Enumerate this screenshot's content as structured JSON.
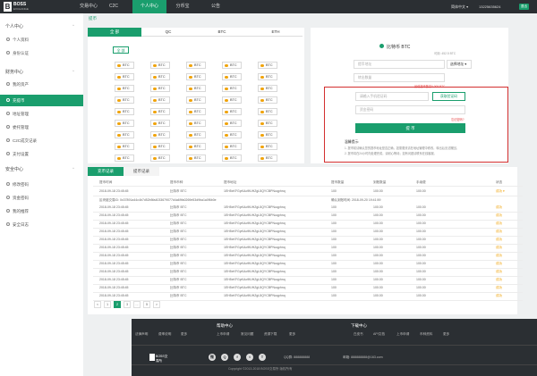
{
  "nav": {
    "logo_name": "BOSS",
    "logo_sub": "EXCHANGE",
    "items": [
      "交易中心",
      "C2C",
      "个人中心",
      "分币宝",
      "公告"
    ],
    "lang": "简体中文 ▾",
    "phone": "13225635624",
    "badge": "退出"
  },
  "sidebar": {
    "groups": [
      {
        "title": "个人中心",
        "items": [
          "个人资料",
          "身份认证"
        ]
      },
      {
        "title": "财务中心",
        "items": [
          "我的资产",
          "充提币",
          "地址管理",
          "委托管理",
          "C2C成交记录",
          "支付设置"
        ]
      },
      {
        "title": "安全中心",
        "items": [
          "修改密码",
          "资金密码",
          "我的推荐",
          "安全日志"
        ]
      }
    ],
    "active": "充提币"
  },
  "breadcrumb": "提币",
  "coins": {
    "tabs": [
      "全 部",
      "QC",
      "BTC",
      "ETH"
    ],
    "all_label": "全 部",
    "coin_label": "BTC"
  },
  "withdraw": {
    "title": "比特币 BTC",
    "subtitle": "可用: 452.5 BTC",
    "address_placeholder": "提币地址",
    "select_label": "选择地址 ▾",
    "amount_placeholder": "转出数量",
    "fee_note": "最低提币数量0.005 BTC",
    "code_placeholder": "请输入手机验证码",
    "code_button": "获取验证码",
    "fund_pw_placeholder": "资金密码",
    "forgot": "忘记密码?",
    "submit": "提 币",
    "tips_title": "温馨提示:",
    "tips": [
      "1. 提币前请确认您的提币地址是否正确，如需更改请在地址管理中修改，转出后无法撤回。",
      "2. 提币将在24小时内处理完成，请耐心等待；如有问题请联系在线客服。"
    ]
  },
  "records": {
    "tabs": [
      "充币记录",
      "提币记录"
    ],
    "headers": [
      "提币时间",
      "提币币种",
      "提币地址",
      "提币数量",
      "到账数量",
      "手续费",
      "状态"
    ],
    "rows": [
      {
        "time": "2018-09-18 23:45:45",
        "coin": "比特币 BTC",
        "addr": "1EH5xKFGpKAo9fUHZgL5QYCBPNuqphnq",
        "qty": "100",
        "net": "100.00",
        "fee": "100.00",
        "status": "成功 ▾"
      },
      {
        "time": "2018-09-18 23:45:45",
        "coin": "比特币 BTC",
        "addr": "1EH5xKFGpKAo9fUHZgL5QYCBPNuqphnq",
        "qty": "100",
        "net": "100.00",
        "fee": "100.00",
        "status": "成功"
      },
      {
        "time": "2018-09-18 23:45:45",
        "coin": "比特币 BTC",
        "addr": "1EH5xKFGpKAo9fUHZgL5QYCBPNuqphnq",
        "qty": "100",
        "net": "100.00",
        "fee": "100.00",
        "status": "成功"
      },
      {
        "time": "2018-09-18 23:45:45",
        "coin": "比特币 BTC",
        "addr": "1EH5xKFGpKAo9fUHZgL5QYCBPNuqphnq",
        "qty": "100",
        "net": "100.00",
        "fee": "100.00",
        "status": "成功"
      },
      {
        "time": "2018-09-18 23:45:45",
        "coin": "比特币 BTC",
        "addr": "1EH5xKFGpKAo9fUHZgL5QYCBPNuqphnq",
        "qty": "100",
        "net": "100.00",
        "fee": "100.00",
        "status": "成功"
      },
      {
        "time": "2018-09-18 23:45:45",
        "coin": "比特币 BTC",
        "addr": "1EH5xKFGpKAo9fUHZgL5QYCBPNuqphnq",
        "qty": "100",
        "net": "100.00",
        "fee": "100.00",
        "status": "成功"
      },
      {
        "time": "2018-09-18 23:45:45",
        "coin": "比特币 BTC",
        "addr": "1EH5xKFGpKAo9fUHZgL5QYCBPNuqphnq",
        "qty": "100",
        "net": "100.00",
        "fee": "100.00",
        "status": "成功"
      },
      {
        "time": "2018-09-18 23:45:45",
        "coin": "比特币 BTC",
        "addr": "1EH5xKFGpKAo9fUHZgL5QYCBPNuqphnq",
        "qty": "100",
        "net": "100.00",
        "fee": "100.00",
        "status": "成功"
      },
      {
        "time": "2018-09-18 23:45:45",
        "coin": "比特币 BTC",
        "addr": "1EH5xKFGpKAo9fUHZgL5QYCBPNuqphnq",
        "qty": "100",
        "net": "100.00",
        "fee": "100.00",
        "status": "成功"
      },
      {
        "time": "2018-09-18 23:45:45",
        "coin": "比特币 BTC",
        "addr": "1EH5xKFGpKAo9fUHZgL5QYCBPNuqphnq",
        "qty": "100",
        "net": "100.00",
        "fee": "100.00",
        "status": "成功"
      },
      {
        "time": "2018-09-18 23:45:45",
        "coin": "比特币 BTC",
        "addr": "1EH5xKFGpKAo9fUHZgL5QYCBPNuqphnq",
        "qty": "100",
        "net": "100.00",
        "fee": "100.00",
        "status": "成功"
      },
      {
        "time": "2018-09-18 23:45:45",
        "coin": "比特币 BTC",
        "addr": "1EH5xKFGpKAo9fUHZgL5QYCBPNuqphnq",
        "qty": "100",
        "net": "100.00",
        "fee": "100.00",
        "status": "成功"
      },
      {
        "time": "2018-09-18 23:45:45",
        "coin": "比特币 BTC",
        "addr": "1EH5xKFGpKAo9fUHZgL5QYCBPNuqphnq",
        "qty": "100",
        "net": "100.00",
        "fee": "100.00",
        "status": "成功"
      }
    ],
    "detail_hash": "区块链交易ID: 0x37891a44c4b7d52b5fa4033679077d4a69fa0269e53d9ba1a0f6b0e",
    "detail_time": "确认到账时间: 2018-09-20 19:41:59",
    "pages": [
      "<",
      "1",
      "2",
      "3",
      "...",
      "5",
      ">"
    ]
  },
  "footer": {
    "help_title": "帮助中心",
    "help_links": [
      "法律声明",
      "费率说明",
      "更多",
      "上币申请",
      "常见问题",
      "资源下载",
      "更多"
    ],
    "download_title": "下载中心",
    "download_links": [
      "白皮书",
      "API文档",
      "上币申请",
      "币种资料",
      "更多"
    ],
    "logo_text": "BOSS交易所",
    "social": [
      "微",
      "Q",
      "f",
      "t",
      "T"
    ],
    "qq": "QQ群: 888888888",
    "email": "邮箱: 888888888@163.com",
    "copyright": "Copyright ©2013-2018 BOSS交易所 版权所有"
  },
  "colors": {
    "accent": "#1a9e6d",
    "nav_bg": "#2b2f33",
    "highlight": "#d32f2f",
    "status": "#f0a30a"
  }
}
